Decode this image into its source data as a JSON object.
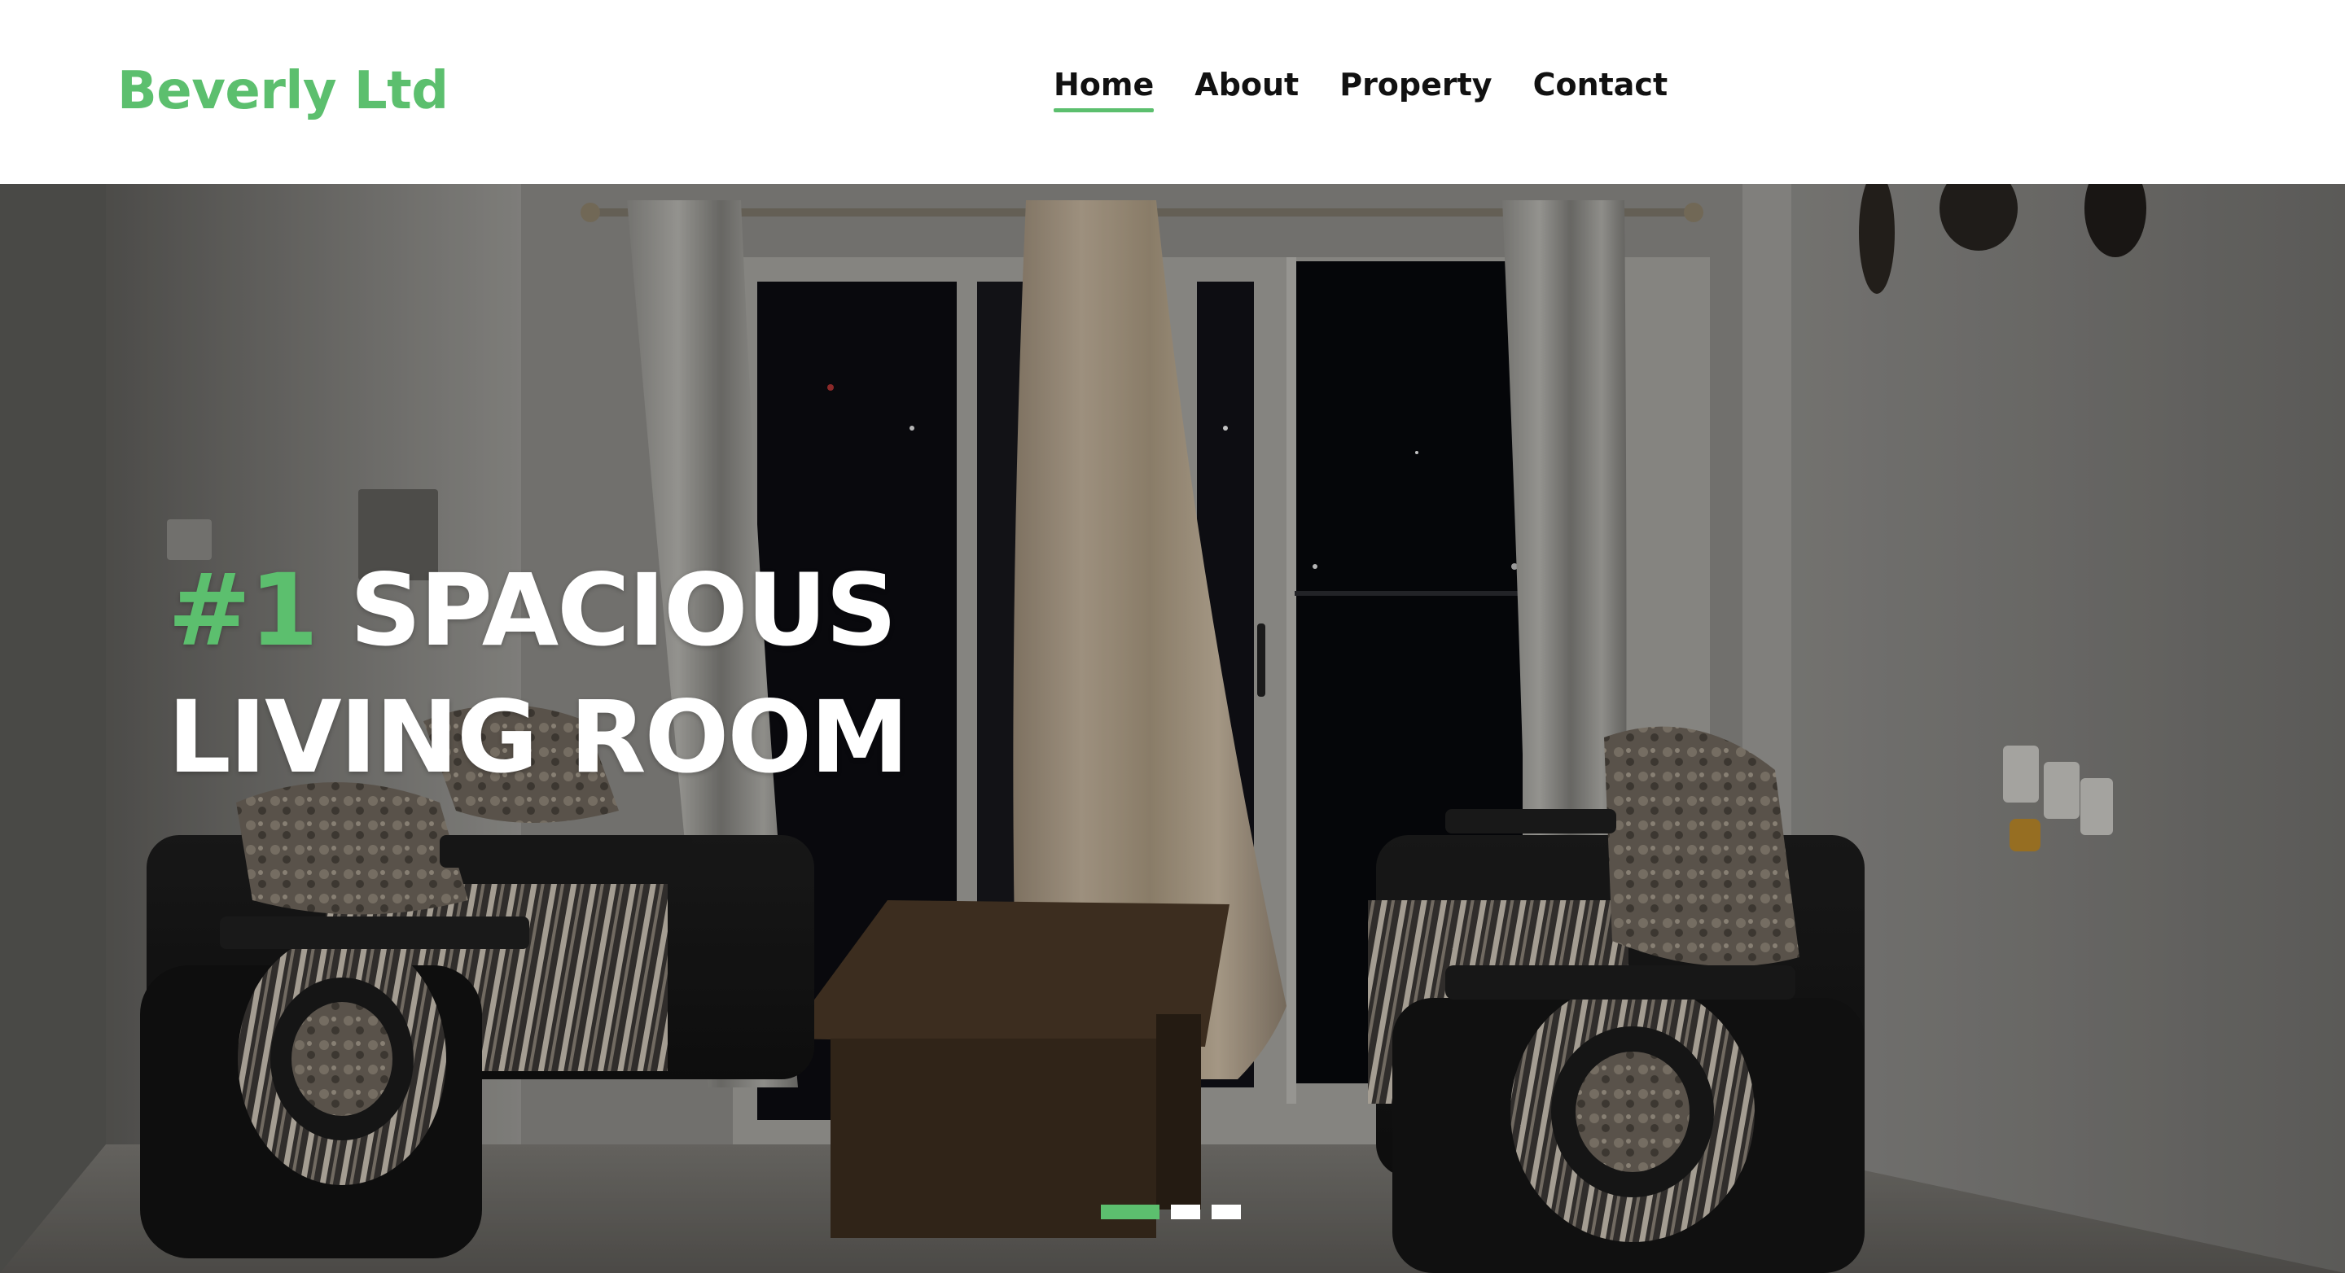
{
  "brand": {
    "name": "Beverly Ltd",
    "color": "#5cbf6e"
  },
  "nav": {
    "items": [
      {
        "label": "Home",
        "active": true
      },
      {
        "label": "About",
        "active": false
      },
      {
        "label": "Property",
        "active": false
      },
      {
        "label": "Contact",
        "active": false
      }
    ]
  },
  "hero": {
    "accent": "#1",
    "line1": "SPACIOUS",
    "line2": "LIVING ROOM",
    "slides": {
      "count": 3,
      "active_index": 0
    }
  },
  "colors": {
    "accent": "#5cbf6e",
    "text_dark": "#111111",
    "hero_text": "#ffffff"
  }
}
